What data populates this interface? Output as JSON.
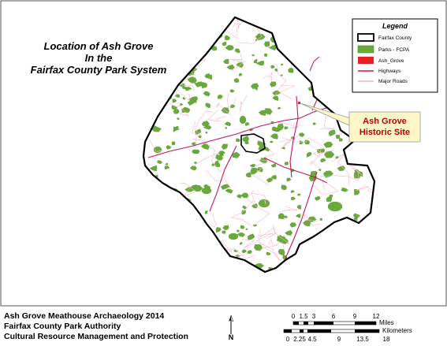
{
  "map": {
    "title_lines": [
      "Location of Ash Grove",
      "In the",
      "Fairfax County Park System"
    ],
    "callout_lines": [
      "Ash Grove",
      "Historic Site"
    ],
    "legend": {
      "title": "Legend",
      "items": [
        {
          "label": "Fairfax County",
          "symbol": "outline-box",
          "color": "#000000"
        },
        {
          "label": "Parks - FCPA",
          "symbol": "filled-box",
          "color": "#6aaa3a"
        },
        {
          "label": "Ash_Grove",
          "symbol": "filled-box",
          "color": "#e52222"
        },
        {
          "label": "Highways",
          "symbol": "line",
          "color": "#c2185b"
        },
        {
          "label": "Major Roads",
          "symbol": "line",
          "color": "#f4b6c8"
        }
      ]
    },
    "footer_lines": [
      "Ash Grove Meathouse Archaeology 2014",
      "Fairfax County Park Authority",
      "Cultural Resource Management and Protection"
    ],
    "north_arrow": {
      "label": "N",
      "icon": "north-arrow-icon"
    },
    "scale_miles": {
      "ticks": [
        "0",
        "1.5",
        "3",
        "6",
        "9",
        "12"
      ],
      "unit": "Miles"
    },
    "scale_km": {
      "ticks": [
        "0",
        "2.25",
        "4.5",
        "9",
        "13.5",
        "18"
      ],
      "unit": "Kilometers"
    },
    "colors": {
      "county_outline": "#000000",
      "parks": "#6aaa3a",
      "ash_grove": "#e52222",
      "highways": "#c2185b",
      "major_roads": "#f4b6c8",
      "callout_fill": "#fdf6c8"
    }
  }
}
